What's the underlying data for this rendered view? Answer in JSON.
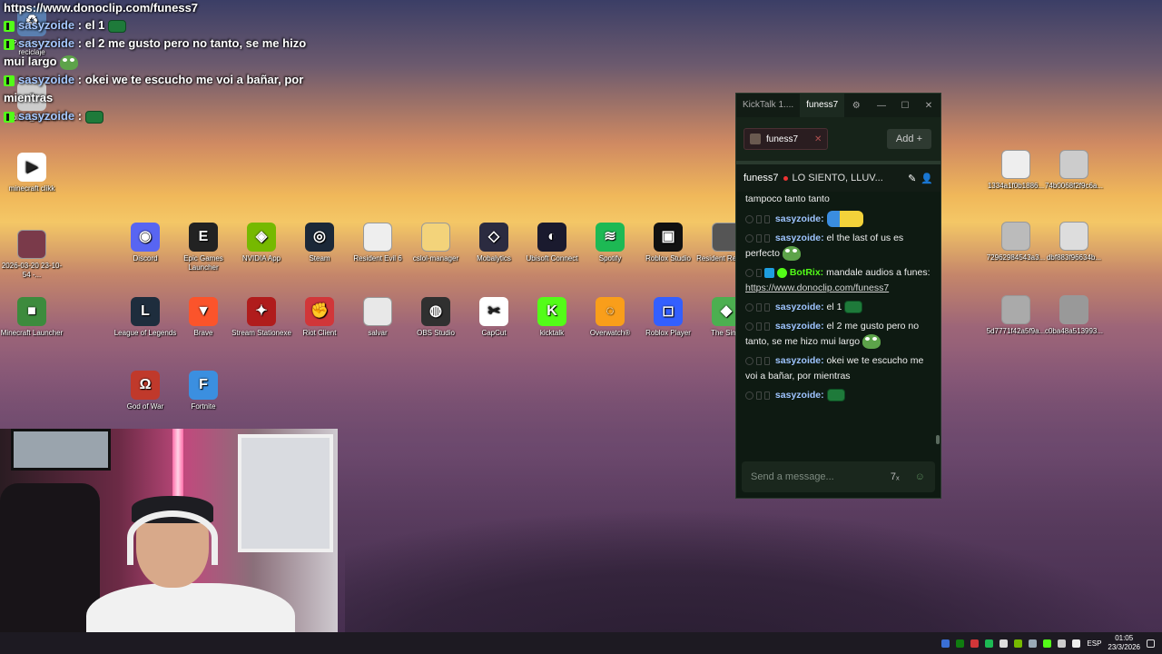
{
  "overlay": {
    "url": "https://www.donoclip.com/funess7",
    "lines": [
      {
        "user": "sasyzoide",
        "text": " : el 1 "
      },
      {
        "user": "sasyzoide",
        "text": " : el 2 me gusto pero no tanto, se me hizo mui largo "
      },
      {
        "user": "sasyzoide",
        "text": " : okei we te escucho me voi a bañar, por mientras"
      },
      {
        "user": "sasyzoide",
        "text": " : "
      }
    ]
  },
  "desktop": {
    "icons": [
      {
        "label": "Papelera de reciclaje",
        "color": "#5a7fb0",
        "glyph": "♻"
      },
      {
        "label": "roblox1_apc......",
        "color": "#cccccc",
        "glyph": "▪"
      },
      {
        "label": "minecraft clikk",
        "color": "#ffffff",
        "glyph": "▶"
      },
      {
        "label": "2026-03-20 23-10-54 -...",
        "color": "#7a3a4a",
        "glyph": ""
      },
      {
        "label": "Discord",
        "color": "#5865f2",
        "glyph": "◉"
      },
      {
        "label": "Epic Games Launcher",
        "color": "#222222",
        "glyph": "E"
      },
      {
        "label": "NVIDIA App",
        "color": "#76b900",
        "glyph": "◈"
      },
      {
        "label": "Steam",
        "color": "#1b2838",
        "glyph": "◎"
      },
      {
        "label": "Resident Evil 6",
        "color": "#eeeeee",
        "glyph": ""
      },
      {
        "label": "cslol-manager",
        "color": "#f3d37a",
        "glyph": ""
      },
      {
        "label": "Mobalytics",
        "color": "#2b2b40",
        "glyph": "◇"
      },
      {
        "label": "Ubisoft Connect",
        "color": "#1a1a2e",
        "glyph": "◐"
      },
      {
        "label": "Spotify",
        "color": "#1db954",
        "glyph": "≋"
      },
      {
        "label": "Roblox Studio",
        "color": "#111111",
        "glyph": "▣"
      },
      {
        "label": "Resident Requie...",
        "color": "#555555",
        "glyph": ""
      },
      {
        "label": "Minecraft Launcher",
        "color": "#3d8b3d",
        "glyph": "■"
      },
      {
        "label": "League of Legends",
        "color": "#1e2d3d",
        "glyph": "L"
      },
      {
        "label": "Brave",
        "color": "#fb542b",
        "glyph": "▼"
      },
      {
        "label": "Stream Stationexe",
        "color": "#b01c1c",
        "glyph": "✦"
      },
      {
        "label": "Riot Client",
        "color": "#d13639",
        "glyph": "✊"
      },
      {
        "label": "salvar",
        "color": "#e8e8e8",
        "glyph": ""
      },
      {
        "label": "OBS Studio",
        "color": "#303030",
        "glyph": "◍"
      },
      {
        "label": "CapCut",
        "color": "#ffffff",
        "glyph": "✂"
      },
      {
        "label": "kicktalk",
        "color": "#53fc18",
        "glyph": "K"
      },
      {
        "label": "Overwatch®",
        "color": "#f99e1a",
        "glyph": "◌"
      },
      {
        "label": "Roblox Player",
        "color": "#335fff",
        "glyph": "◻"
      },
      {
        "label": "The Sims",
        "color": "#4caf50",
        "glyph": "◆"
      },
      {
        "label": "God of War",
        "color": "#c0392b",
        "glyph": "Ω"
      },
      {
        "label": "Fortnite",
        "color": "#3b8fe0",
        "glyph": "F"
      },
      {
        "label": "1334a1f0b1886...",
        "color": "#eeeeee",
        "glyph": ""
      },
      {
        "label": "74b0068f2f9c6a...",
        "color": "#cccccc",
        "glyph": ""
      },
      {
        "label": "72962984543a3...",
        "color": "#bbbbbb",
        "glyph": ""
      },
      {
        "label": "dbf883f96634b...",
        "color": "#dddddd",
        "glyph": ""
      },
      {
        "label": "5d7771f42a5f9a...",
        "color": "#aaaaaa",
        "glyph": ""
      },
      {
        "label": "c0ba48a513993...",
        "color": "#999999",
        "glyph": ""
      }
    ]
  },
  "kicktalk": {
    "title_tab": "KickTalk 1....",
    "active_tab": "funess7",
    "channel": "funess7",
    "add_label": "Add",
    "add_icon": "+",
    "header_user": "funess7",
    "pinned": "LO SIENTO, LLUV...",
    "messages": [
      {
        "user": "",
        "text": "tampoco tanto tanto"
      },
      {
        "user": "sasyzoide:",
        "text": ""
      },
      {
        "user": "sasyzoide:",
        "text": " el the last of us es perfecto"
      },
      {
        "user": "BotRix:",
        "text": " mandale audios a funes: ",
        "link": "https://www.donoclip.com/funess7",
        "bot": true
      },
      {
        "user": "sasyzoide:",
        "text": " el 1"
      },
      {
        "user": "sasyzoide:",
        "text": " el 2 me gusto pero no tanto, se me hizo mui largo"
      },
      {
        "user": "sasyzoide:",
        "text": " okei we te escucho me voi a bañar, por mientras"
      },
      {
        "user": "sasyzoide:",
        "text": ""
      }
    ],
    "input_placeholder": "Send a message...",
    "colors": {
      "accent": "#53fc18",
      "username": "#9ec4ff"
    }
  },
  "taskbar": {
    "lang": "ESP",
    "time": "01:05",
    "date": "23/3/2026"
  }
}
